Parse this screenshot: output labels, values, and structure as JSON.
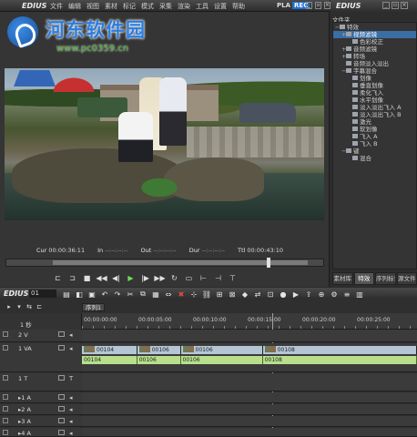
{
  "player": {
    "app_name": "EDIUS",
    "menu": [
      "文件",
      "编辑",
      "视图",
      "素材",
      "标记",
      "模式",
      "采集",
      "渲染",
      "工具",
      "设置",
      "帮助"
    ],
    "pla": "PLA",
    "rec": "REC",
    "watermark_url": "www.pc0359.cn",
    "timecodes": {
      "cur_label": "Cur",
      "cur_value": "00:00:36:11",
      "in_label": "In",
      "in_value": "--:--:--:--",
      "out_label": "Out",
      "out_value": "--:--:--:--",
      "dur_label": "Dur",
      "dur_value": "--:--:--:--",
      "ttl_label": "Ttl",
      "ttl_value": "00:00:43:10"
    },
    "scrub_position": 0.82
  },
  "panel": {
    "app_name": "EDIUS",
    "header": "文件夹",
    "tree": [
      {
        "label": "特效",
        "indent": 0,
        "exp": "−"
      },
      {
        "label": "视频滤镜",
        "indent": 1,
        "exp": "+",
        "selected": true
      },
      {
        "label": "色彩校正",
        "indent": 2,
        "exp": ""
      },
      {
        "label": "音频滤镜",
        "indent": 1,
        "exp": "+"
      },
      {
        "label": "转场",
        "indent": 1,
        "exp": "+"
      },
      {
        "label": "音频淡入淡出",
        "indent": 1,
        "exp": ""
      },
      {
        "label": "字幕混合",
        "indent": 1,
        "exp": "−"
      },
      {
        "label": "划像",
        "indent": 2,
        "exp": ""
      },
      {
        "label": "垂直划像",
        "indent": 2,
        "exp": ""
      },
      {
        "label": "柔化飞入",
        "indent": 2,
        "exp": ""
      },
      {
        "label": "水平划像",
        "indent": 2,
        "exp": ""
      },
      {
        "label": "淡入淡出飞入 A",
        "indent": 2,
        "exp": ""
      },
      {
        "label": "淡入淡出飞入 B",
        "indent": 2,
        "exp": ""
      },
      {
        "label": "激光",
        "indent": 2,
        "exp": ""
      },
      {
        "label": "软划像",
        "indent": 2,
        "exp": ""
      },
      {
        "label": "飞入 A",
        "indent": 2,
        "exp": ""
      },
      {
        "label": "飞入 B",
        "indent": 2,
        "exp": ""
      },
      {
        "label": "键",
        "indent": 1,
        "exp": "−"
      },
      {
        "label": "混合",
        "indent": 2,
        "exp": ""
      }
    ],
    "tabs": [
      "素材库",
      "特效",
      "序列标记",
      "源文件"
    ]
  },
  "timeline": {
    "app_name": "EDIUS",
    "number": "01",
    "sequence_tab": "序列1",
    "zoom_label": "1 秒",
    "ruler": [
      "00:00:00:00",
      "00:00:05:00",
      "00:00:10:00",
      "00:00:15:00",
      "00:00:20:00",
      "00:00:25:00"
    ],
    "tracks": [
      {
        "name": "2 V",
        "kind": "video"
      },
      {
        "name": "1 VA",
        "kind": "va"
      },
      {
        "name": "1 T",
        "kind": "title"
      },
      {
        "name": "▸1 A",
        "kind": "audio"
      },
      {
        "name": "▸2 A",
        "kind": "audio"
      },
      {
        "name": "▸3 A",
        "kind": "audio"
      },
      {
        "name": "▸4 A",
        "kind": "audio"
      }
    ],
    "clips": [
      {
        "name": "00104",
        "start": 0,
        "len": 0.165
      },
      {
        "name": "00106",
        "start": 0.165,
        "len": 0.13
      },
      {
        "name": "00106",
        "start": 0.295,
        "len": 0.245
      },
      {
        "name": "00108",
        "start": 0.54,
        "len": 0.46
      }
    ]
  }
}
